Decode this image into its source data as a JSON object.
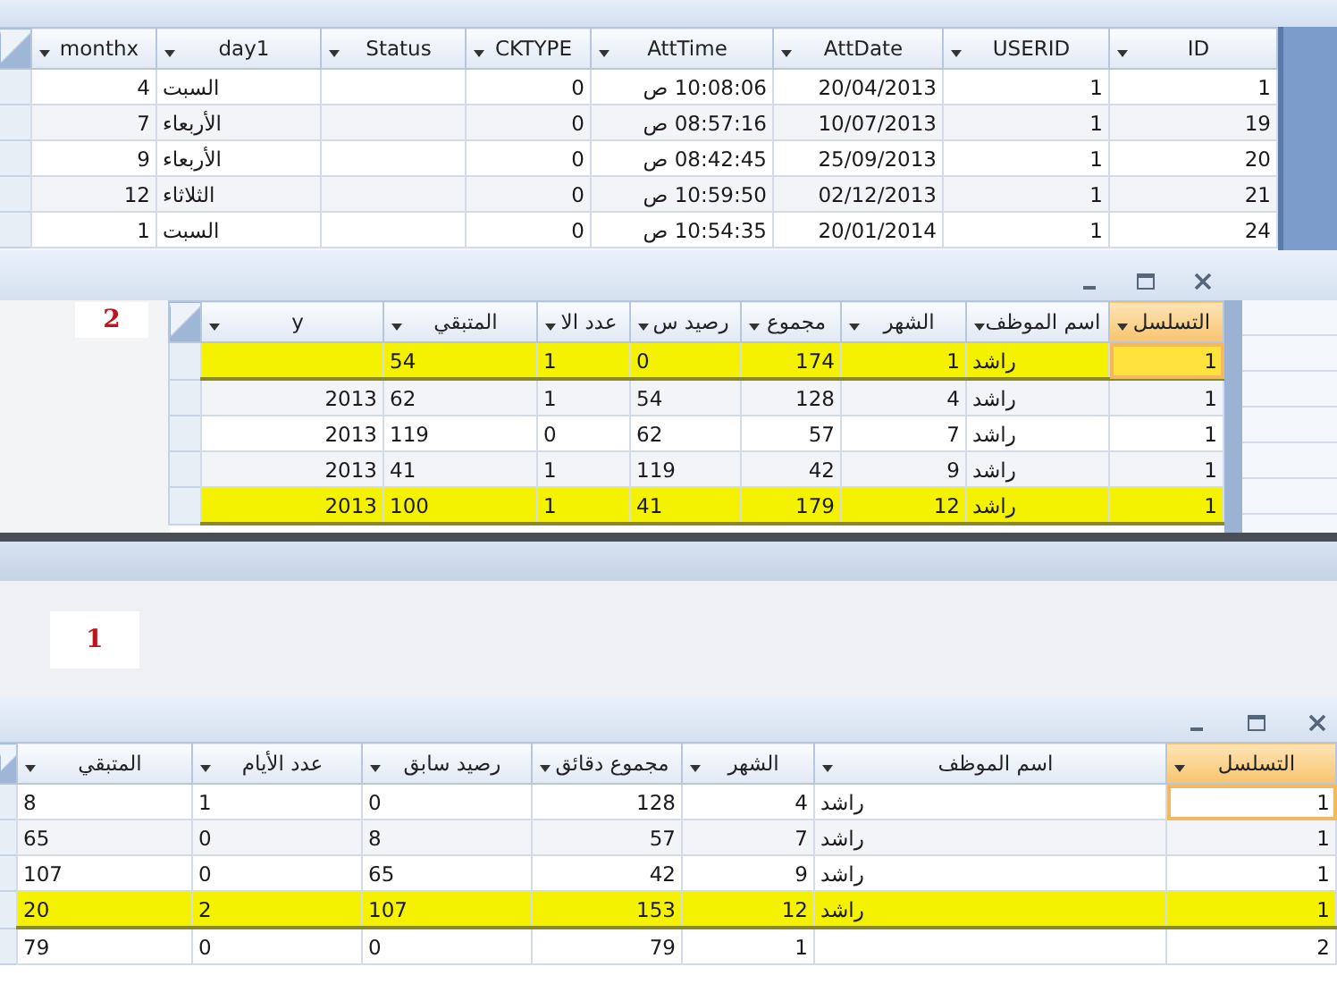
{
  "attendance_table": {
    "columns": [
      {
        "label": "ID",
        "kind": "number",
        "selected": false
      },
      {
        "label": "USERID",
        "kind": "number",
        "selected": false
      },
      {
        "label": "AttDate",
        "kind": "number",
        "selected": false
      },
      {
        "label": "AttTime",
        "kind": "number",
        "selected": false
      },
      {
        "label": "CKTYPE",
        "kind": "number",
        "selected": false
      },
      {
        "label": "Status",
        "kind": "text",
        "selected": false
      },
      {
        "label": "day1",
        "kind": "text",
        "selected": false
      },
      {
        "label": "monthx",
        "kind": "number",
        "selected": false
      }
    ],
    "rows": [
      {
        "cells": [
          "1",
          "1",
          "20/04/2013",
          "10:08:06 ص",
          "0",
          null,
          "السبت",
          "4"
        ],
        "highlighted": false
      },
      {
        "cells": [
          "19",
          "1",
          "10/07/2013",
          "08:57:16 ص",
          "0",
          null,
          "الأربعاء",
          "7"
        ],
        "highlighted": false
      },
      {
        "cells": [
          "20",
          "1",
          "25/09/2013",
          "08:42:45 ص",
          "0",
          null,
          "الأربعاء",
          "9"
        ],
        "highlighted": false
      },
      {
        "cells": [
          "21",
          "1",
          "02/12/2013",
          "10:59:50 ص",
          "0",
          null,
          "الثلاثاء",
          "12"
        ],
        "highlighted": false
      },
      {
        "cells": [
          "24",
          "1",
          "20/01/2014",
          "10:54:35 ص",
          "0",
          null,
          "السبت",
          "1"
        ],
        "highlighted": false
      }
    ]
  },
  "query_window": {
    "annotation": "2",
    "table": {
      "columns": [
        {
          "label": "التسلسل",
          "kind": "number",
          "selected": true
        },
        {
          "label": "اسم الموظف",
          "kind": "text",
          "selected": false
        },
        {
          "label": "الشهر",
          "kind": "number",
          "selected": false
        },
        {
          "label": "مجموع",
          "kind": "number",
          "selected": false
        },
        {
          "label": "رصيد س",
          "kind": "text",
          "selected": false
        },
        {
          "label": "عدد الا",
          "kind": "text",
          "selected": false
        },
        {
          "label": "المتبقي",
          "kind": "text",
          "selected": false
        },
        {
          "label": "y",
          "kind": "number",
          "selected": false
        }
      ],
      "rows": [
        {
          "cells": [
            "1",
            "راشد",
            "1",
            "174",
            "0",
            "1",
            "54",
            null
          ],
          "highlighted": true,
          "current": true
        },
        {
          "cells": [
            "1",
            "راشد",
            "4",
            "128",
            "54",
            "1",
            "62",
            "2013"
          ],
          "highlighted": false,
          "current": false
        },
        {
          "cells": [
            "1",
            "راشد",
            "7",
            "57",
            "62",
            "0",
            "119",
            "2013"
          ],
          "highlighted": false,
          "current": false
        },
        {
          "cells": [
            "1",
            "راشد",
            "9",
            "42",
            "119",
            "1",
            "41",
            "2013"
          ],
          "highlighted": false,
          "current": false
        },
        {
          "cells": [
            "1",
            "راشد",
            "12",
            "179",
            "41",
            "1",
            "100",
            "2013"
          ],
          "highlighted": true,
          "current": false
        }
      ]
    }
  },
  "middle_annotation": "1",
  "result_window": {
    "table": {
      "columns": [
        {
          "label": "التسلسل",
          "kind": "number",
          "selected": true
        },
        {
          "label": "اسم الموظف",
          "kind": "text",
          "selected": false
        },
        {
          "label": "الشهر",
          "kind": "number",
          "selected": false
        },
        {
          "label": "مجموع دقائق",
          "kind": "number",
          "selected": false
        },
        {
          "label": "رصيد سابق",
          "kind": "text",
          "selected": false
        },
        {
          "label": "عدد الأيام",
          "kind": "text",
          "selected": false
        },
        {
          "label": "المتبقي",
          "kind": "text",
          "selected": false
        }
      ],
      "rows": [
        {
          "cells": [
            "1",
            "راشد",
            "4",
            "128",
            "0",
            "1",
            "8"
          ],
          "highlighted": false,
          "current": true
        },
        {
          "cells": [
            "1",
            "راشد",
            "7",
            "57",
            "8",
            "0",
            "65"
          ],
          "highlighted": false,
          "current": false
        },
        {
          "cells": [
            "1",
            "راشد",
            "9",
            "42",
            "65",
            "0",
            "107"
          ],
          "highlighted": false,
          "current": false
        },
        {
          "cells": [
            "1",
            "راشد",
            "12",
            "153",
            "107",
            "2",
            "20"
          ],
          "highlighted": true,
          "current": false
        },
        {
          "cells": [
            "2",
            null,
            "1",
            "79",
            "0",
            "0",
            "79"
          ],
          "highlighted": false,
          "current": false
        }
      ]
    }
  }
}
